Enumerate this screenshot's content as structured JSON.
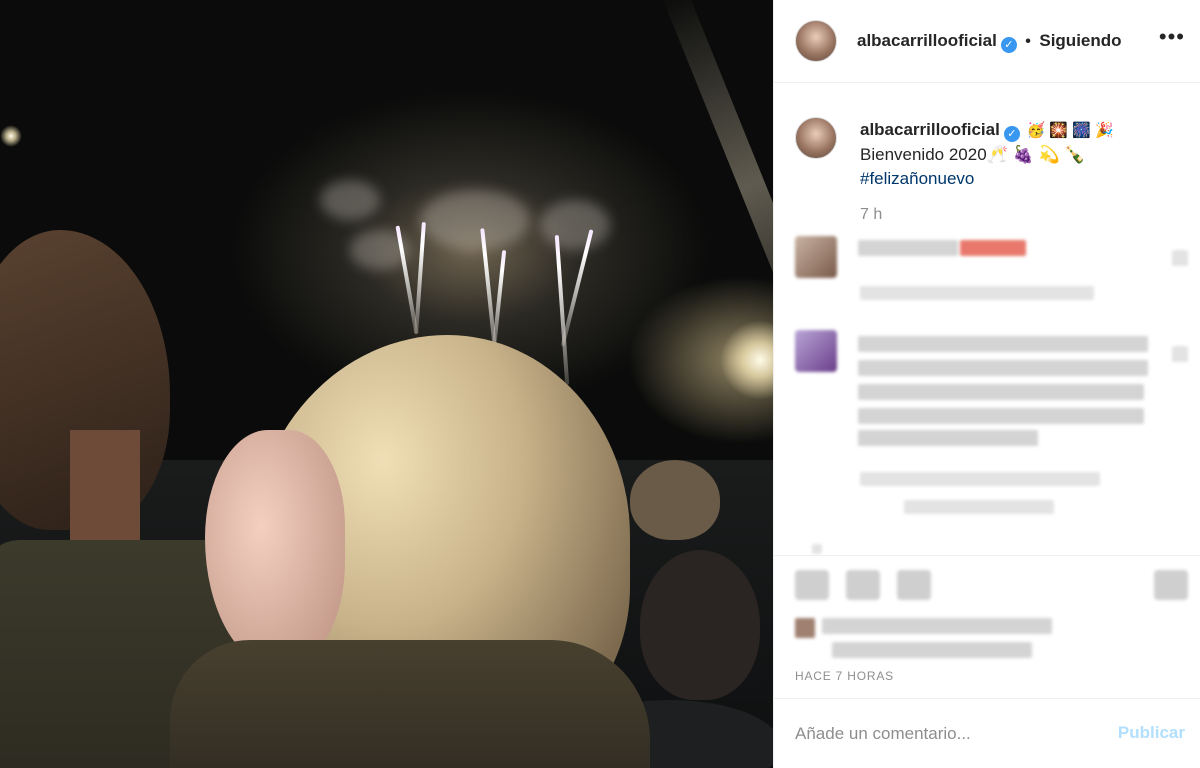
{
  "post": {
    "username": "albacarrillooficial",
    "verified_icon": "verified-badge-icon",
    "separator": "•",
    "follow_status": "Siguiendo",
    "more_icon": "more-options-icon"
  },
  "caption": {
    "username": "albacarrillooficial",
    "emojis_line1": "🥳 🎇 🎆 🎉",
    "line2": "Bienvenido 2020🥂 🍇 💫 🍾",
    "hashtag": "#felizañonuevo",
    "time_ago": "7 h"
  },
  "footer": {
    "timestamp": "HACE 7 HORAS",
    "comment_placeholder": "Añade un comentario...",
    "publish_label": "Publicar"
  },
  "colors": {
    "accent": "#3897f0",
    "publish_disabled": "#b2dffc",
    "muted": "#8e8e8e"
  }
}
